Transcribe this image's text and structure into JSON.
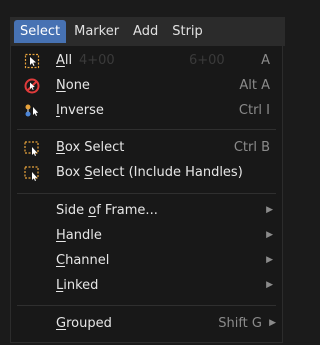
{
  "menubar": {
    "items": [
      {
        "label": "Select"
      },
      {
        "label": "Marker"
      },
      {
        "label": "Add"
      },
      {
        "label": "Strip"
      }
    ]
  },
  "select_menu": {
    "all": {
      "label_u": "A",
      "label_rest": "ll",
      "shortcut": "A",
      "ghost_left": "4+00",
      "ghost_right": "6+00"
    },
    "none": {
      "label_u": "N",
      "label_rest": "one",
      "shortcut": "Alt A"
    },
    "inverse": {
      "label_u": "I",
      "label_rest": "nverse",
      "shortcut": "Ctrl I"
    },
    "box_select": {
      "label_pre": "",
      "label_u": "B",
      "label_rest": "ox Select",
      "shortcut": "Ctrl B"
    },
    "box_select_handles": {
      "label_pre": "Box ",
      "label_u": "S",
      "label_rest": "elect (Include Handles)"
    },
    "side_of_frame": {
      "label_pre": "Side ",
      "label_u": "o",
      "label_rest": "f Frame..."
    },
    "handle": {
      "label_u": "H",
      "label_rest": "andle"
    },
    "channel": {
      "label_u": "C",
      "label_rest": "hannel"
    },
    "linked": {
      "label_u": "L",
      "label_rest": "inked"
    },
    "grouped": {
      "label_u": "G",
      "label_rest": "rouped",
      "shortcut": "Shift G"
    },
    "submenu_arrow": "▶"
  },
  "colors": {
    "accent": "#4772b3",
    "icon_orange": "#e8a33c",
    "icon_red": "#e03b3b"
  },
  "icons": [
    "select-all-icon",
    "select-none-icon",
    "select-inverse-icon",
    "box-select-icon",
    "box-select-handles-icon"
  ]
}
